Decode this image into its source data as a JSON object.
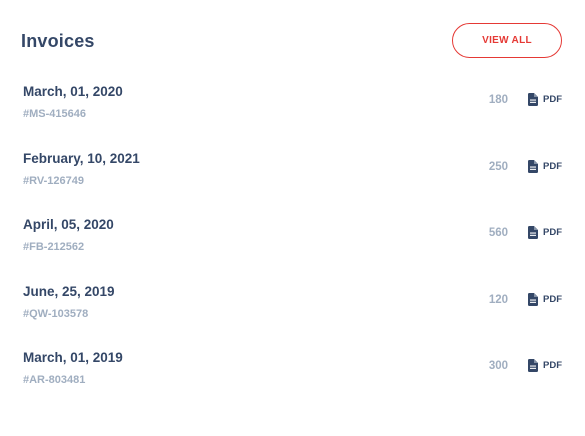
{
  "header": {
    "title": "Invoices",
    "view_all_label": "VIEW ALL"
  },
  "invoices": [
    {
      "date": "March, 01, 2020",
      "id": "#MS-415646",
      "amount": "180",
      "link_label": "PDF",
      "icon": "document-icon"
    },
    {
      "date": "February, 10, 2021",
      "id": "#RV-126749",
      "amount": "250",
      "link_label": "PDF",
      "icon": "document-icon"
    },
    {
      "date": "April, 05, 2020",
      "id": "#FB-212562",
      "amount": "560",
      "link_label": "PDF",
      "icon": "document-icon"
    },
    {
      "date": "June, 25, 2019",
      "id": "#QW-103578",
      "amount": "120",
      "link_label": "PDF",
      "icon": "document-icon"
    },
    {
      "date": "March, 01, 2019",
      "id": "#AR-803481",
      "amount": "300",
      "link_label": "PDF",
      "icon": "document-icon"
    }
  ],
  "colors": {
    "accent": "#e53935",
    "heading": "#344767",
    "muted": "#a0aec0",
    "background": "#ffffff"
  }
}
